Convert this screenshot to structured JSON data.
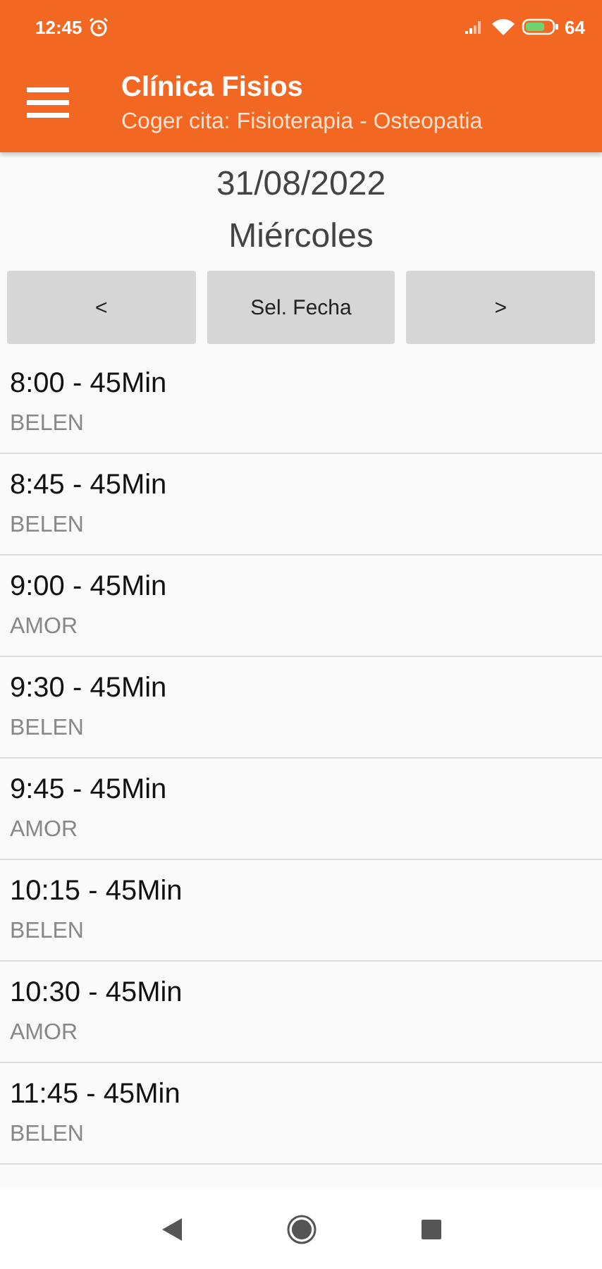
{
  "status_bar": {
    "time": "12:45",
    "battery": "64"
  },
  "app_bar": {
    "title": "Clínica Fisios",
    "subtitle": "Coger cita: Fisioterapia - Osteopatia"
  },
  "date": "31/08/2022",
  "weekday": "Miércoles",
  "buttons": [
    {
      "label": "<"
    },
    {
      "label": "Sel. Fecha"
    },
    {
      "label": ">"
    }
  ],
  "slots": [
    {
      "time": "8:00 - 45Min",
      "person": "BELEN"
    },
    {
      "time": "8:45 - 45Min",
      "person": "BELEN"
    },
    {
      "time": "9:00 - 45Min",
      "person": "AMOR"
    },
    {
      "time": "9:30 - 45Min",
      "person": "BELEN"
    },
    {
      "time": "9:45 - 45Min",
      "person": "AMOR"
    },
    {
      "time": "10:15 - 45Min",
      "person": "BELEN"
    },
    {
      "time": "10:30 - 45Min",
      "person": "AMOR"
    },
    {
      "time": "11:45 - 45Min",
      "person": "BELEN"
    }
  ]
}
